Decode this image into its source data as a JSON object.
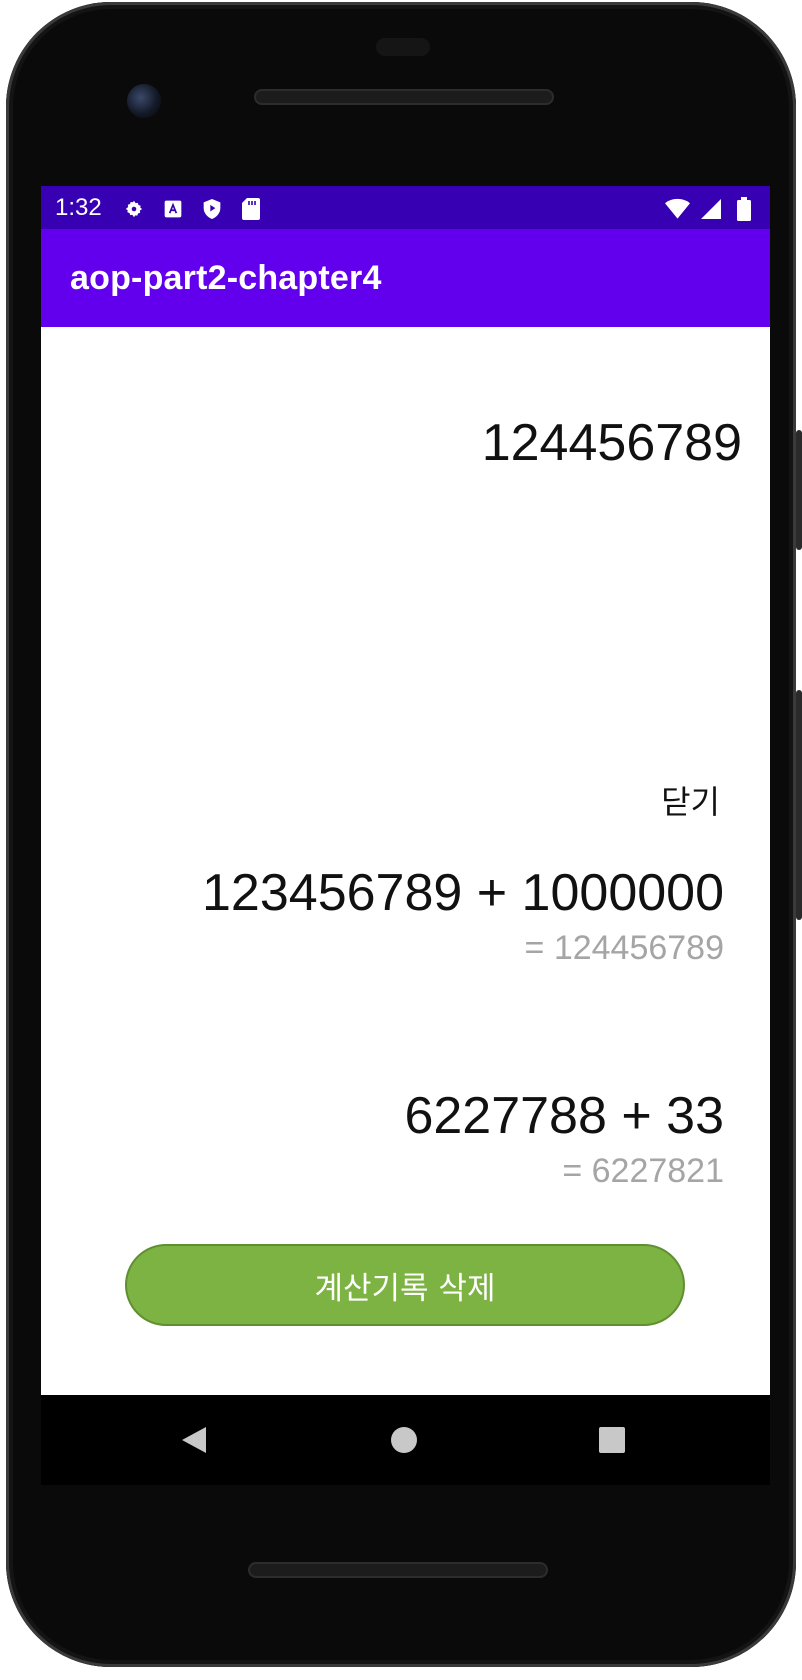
{
  "status_bar": {
    "time": "1:32",
    "left_icons": [
      "gear-icon",
      "keyboard-a-icon",
      "shield-play-icon",
      "sd-card-icon"
    ],
    "right_icons": [
      "wifi-icon",
      "cell-signal-icon",
      "battery-icon"
    ]
  },
  "app_bar": {
    "title": "aop-part2-chapter4",
    "color": "#6200ee"
  },
  "calculator": {
    "display_value": "124456789"
  },
  "history_panel": {
    "close_label": "닫기",
    "entries": [
      {
        "expression": "123456789 + 1000000",
        "result": "= 124456789"
      },
      {
        "expression": "6227788 + 33",
        "result": "= 6227821"
      }
    ],
    "clear_button_label": "계산기록 삭제",
    "clear_button_color": "#7cb342"
  },
  "nav_bar": {
    "icons": [
      "back-icon",
      "home-icon",
      "recents-icon"
    ]
  }
}
